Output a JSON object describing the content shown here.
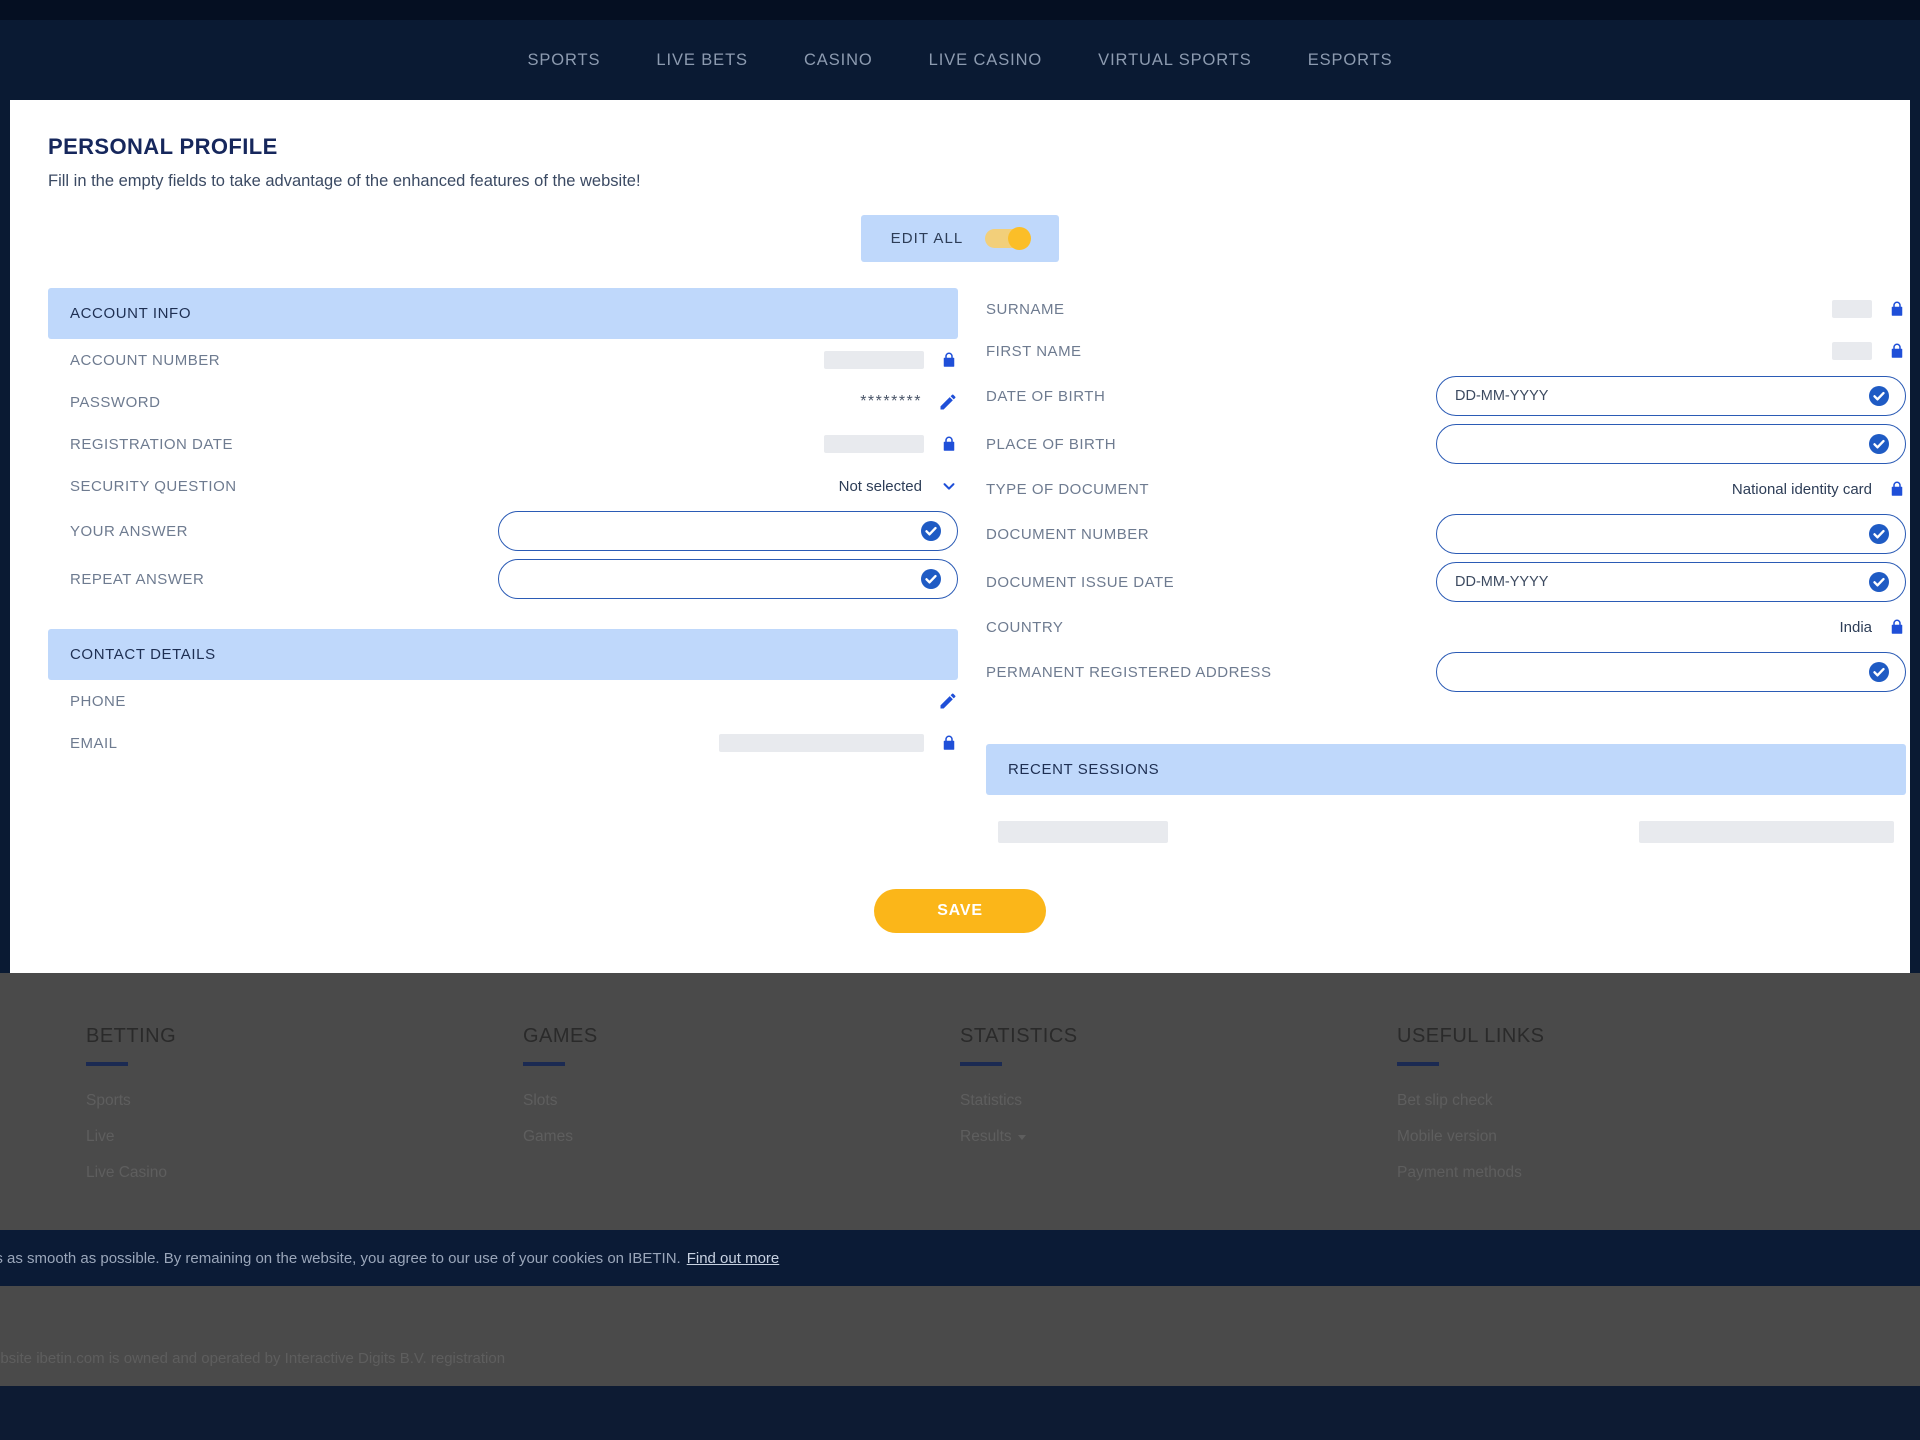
{
  "nav": {
    "items": [
      {
        "label": "SPORTS"
      },
      {
        "label": "LIVE BETS"
      },
      {
        "label": "CASINO"
      },
      {
        "label": "LIVE CASINO"
      },
      {
        "label": "VIRTUAL SPORTS"
      },
      {
        "label": "ESPORTS"
      }
    ]
  },
  "page": {
    "title": "PERSONAL PROFILE",
    "subtitle": "Fill in the empty fields to take advantage of the enhanced features of the website!",
    "edit_all_label": "EDIT ALL",
    "save_label": "SAVE"
  },
  "account_info": {
    "header": "ACCOUNT INFO",
    "rows": {
      "account_number": {
        "label": "ACCOUNT NUMBER",
        "value": "",
        "redacted": true
      },
      "password": {
        "label": "PASSWORD",
        "value": "********"
      },
      "registration_date": {
        "label": "REGISTRATION DATE",
        "value": "",
        "redacted": true
      },
      "security_question": {
        "label": "SECURITY QUESTION",
        "value": "Not selected"
      },
      "your_answer": {
        "label": "YOUR ANSWER",
        "value": "",
        "placeholder": ""
      },
      "repeat_answer": {
        "label": "REPEAT ANSWER",
        "value": "",
        "placeholder": ""
      }
    }
  },
  "contact_details": {
    "header": "CONTACT DETAILS",
    "rows": {
      "phone": {
        "label": "PHONE",
        "value": ""
      },
      "email": {
        "label": "EMAIL",
        "value": "",
        "redacted": true
      }
    }
  },
  "personal_details": {
    "rows": {
      "surname": {
        "label": "SURNAME",
        "value": "",
        "redacted": true
      },
      "first_name": {
        "label": "FIRST NAME",
        "value": "",
        "redacted": true
      },
      "date_of_birth": {
        "label": "DATE OF BIRTH",
        "value": "",
        "placeholder": "DD-MM-YYYY"
      },
      "place_of_birth": {
        "label": "PLACE OF BIRTH",
        "value": "",
        "placeholder": ""
      },
      "type_of_document": {
        "label": "TYPE OF DOCUMENT",
        "value": "National identity card"
      },
      "document_number": {
        "label": "DOCUMENT NUMBER",
        "value": "",
        "placeholder": ""
      },
      "document_issue_date": {
        "label": "DOCUMENT ISSUE DATE",
        "value": "",
        "placeholder": "DD-MM-YYYY"
      },
      "country": {
        "label": "COUNTRY",
        "value": "India"
      },
      "permanent_registered_address": {
        "label": "PERMANENT REGISTERED ADDRESS",
        "value": "",
        "placeholder": ""
      }
    }
  },
  "recent_sessions": {
    "header": "RECENT SESSIONS"
  },
  "footer": {
    "columns": [
      {
        "title": "BETTING",
        "links": [
          {
            "label": "Sports"
          },
          {
            "label": "Live"
          },
          {
            "label": "Live Casino"
          }
        ]
      },
      {
        "title": "GAMES",
        "links": [
          {
            "label": "Slots"
          },
          {
            "label": "Games"
          }
        ]
      },
      {
        "title": "STATISTICS",
        "links": [
          {
            "label": "Statistics"
          },
          {
            "label": "Results",
            "caret": true
          }
        ]
      },
      {
        "title": "USEFUL LINKS",
        "links": [
          {
            "label": "Bet slip check"
          },
          {
            "label": "Mobile version"
          },
          {
            "label": "Payment methods"
          }
        ]
      }
    ]
  },
  "cookie_bar": {
    "text": "is as smooth as possible. By remaining on the website, you agree to our use of your cookies on IBETIN.",
    "link": "Find out more"
  },
  "legal": {
    "text": "ebsite ibetin.com is owned and operated by Interactive Digits B.V. registration"
  },
  "colors": {
    "brand_navy": "#0a1a33",
    "accent_blue": "#2b5bb5",
    "section_blue": "#bfd8fb",
    "save_amber": "#fbb619",
    "toggle_amber": "#fbbe28"
  }
}
